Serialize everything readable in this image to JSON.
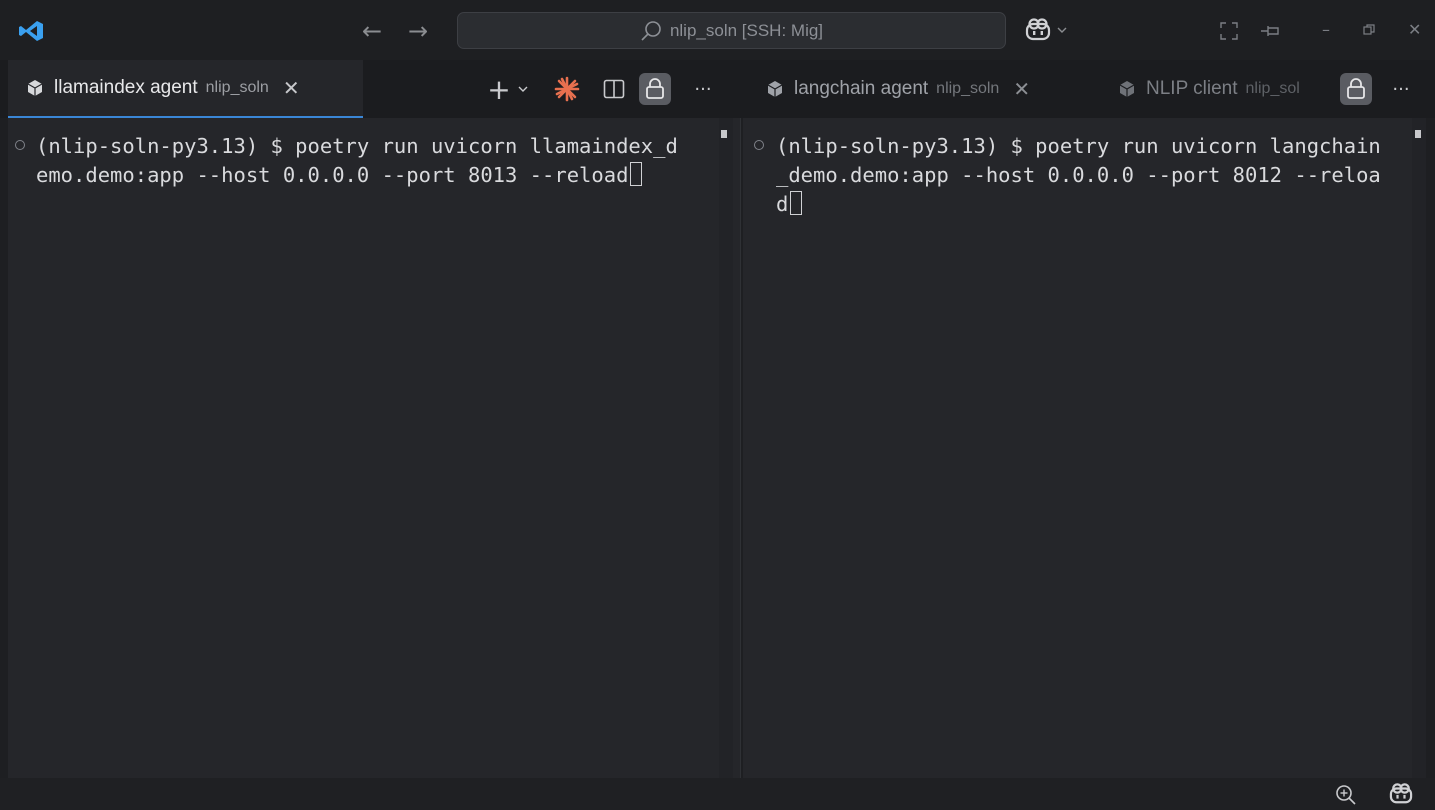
{
  "titlebar": {
    "command_center_text": "nlip_soln [SSH: Mig]",
    "back_icon": "arrow-left-icon",
    "forward_icon": "arrow-right-icon",
    "search_icon": "search-icon",
    "copilot_icon": "copilot-icon",
    "window_controls": [
      "layout-icon",
      "pin-icon",
      "minimize-icon",
      "restore-icon",
      "close-icon"
    ]
  },
  "left_group": {
    "tabs": [
      {
        "title": "llamaindex agent",
        "subtitle": "nlip_soln",
        "active": true
      }
    ],
    "toolbar": {
      "new_terminal": "+",
      "split": "split-editor-icon",
      "lock": "lock-icon",
      "more": "···"
    }
  },
  "right_group": {
    "tabs": [
      {
        "title": "langchain agent",
        "subtitle": "nlip_soln",
        "active": false
      },
      {
        "title": "NLIP client",
        "subtitle": "nlip_sol",
        "active": false
      }
    ],
    "more": "···"
  },
  "terminals": {
    "left": {
      "lines": [
        "(nlip-soln-py3.13) $ poetry run uvicorn llamaindex_d",
        "emo.demo:app --host 0.0.0.0 --port 8013 --reload"
      ]
    },
    "right": {
      "lines": [
        "(nlip-soln-py3.13) $ poetry run uvicorn langchain",
        "_demo.demo:app --host 0.0.0.0 --port 8012 --reloa",
        "d"
      ]
    }
  },
  "statusbar": {
    "zoom_icon": "zoom-in-icon",
    "copilot_icon": "copilot-icon"
  },
  "colors": {
    "accent": "#3a86d6",
    "background": "#1e1f22",
    "terminal_bg": "#25262a",
    "claude_icon": "#e8704f"
  }
}
